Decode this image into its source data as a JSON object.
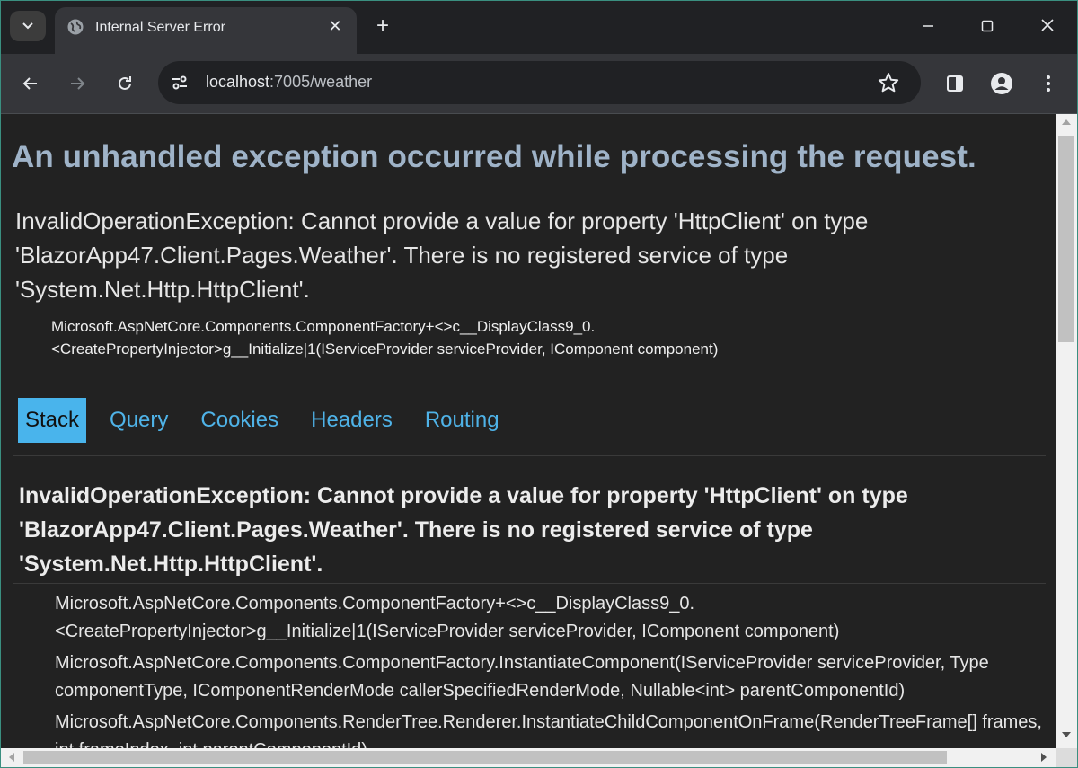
{
  "browser": {
    "tab_title": "Internal Server Error",
    "url_host": "localhost",
    "url_rest": ":7005/weather",
    "new_tab_symbol": "+",
    "close_tab_symbol": "✕",
    "icons": [
      "tab-search-icon",
      "globe-icon",
      "close-icon",
      "plus-icon",
      "minimize-icon",
      "maximize-icon",
      "close-window-icon",
      "back-arrow-icon",
      "forward-arrow-icon",
      "reload-icon",
      "site-info-icon",
      "star-icon",
      "side-panel-icon",
      "profile-icon",
      "kebab-menu-icon"
    ]
  },
  "page": {
    "heading": "An unhandled exception occurred while processing the request.",
    "title_error": "InvalidOperationException: Cannot provide a value for property 'HttpClient' on type 'BlazorApp47.Client.Pages.Weather'. There is no registered service of type 'System.Net.Http.HttpClient'.",
    "location_line1": "Microsoft.AspNetCore.Components.ComponentFactory+<>c__DisplayClass9_0.",
    "location_line2": "<CreatePropertyInjector>g__Initialize|1(IServiceProvider serviceProvider, IComponent component)",
    "tabs": [
      "Stack",
      "Query",
      "Cookies",
      "Headers",
      "Routing"
    ],
    "selected_tab": "Stack",
    "stack_heading": "InvalidOperationException: Cannot provide a value for property 'HttpClient' on type 'BlazorApp47.Client.Pages.Weather'. There is no registered service of type 'System.Net.Http.HttpClient'.",
    "frames": [
      "Microsoft.AspNetCore.Components.ComponentFactory+<>c__DisplayClass9_0.<CreatePropertyInjector>g__Initialize|1(IServiceProvider serviceProvider, IComponent component)",
      "Microsoft.AspNetCore.Components.ComponentFactory.InstantiateComponent(IServiceProvider serviceProvider, Type componentType, IComponentRenderMode callerSpecifiedRenderMode, Nullable<int> parentComponentId)",
      "Microsoft.AspNetCore.Components.RenderTree.Renderer.InstantiateChildComponentOnFrame(RenderTreeFrame[] frames, int frameIndex, int parentComponentId)"
    ]
  },
  "colors": {
    "heading": "#9fb3c8",
    "tab_accent": "#49b4ec",
    "tab_link": "#4fb3e8",
    "page_bg": "#222222"
  }
}
